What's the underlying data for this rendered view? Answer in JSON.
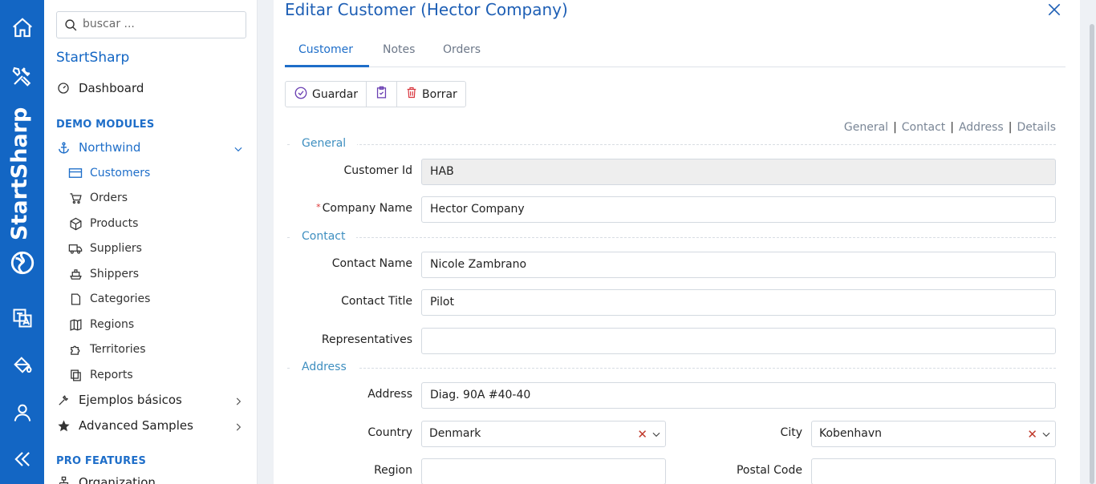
{
  "rail": {
    "brand": "StartSharp",
    "icons": [
      "home-icon",
      "tools-icon",
      "translate-icon",
      "paint-bucket-icon",
      "user-icon",
      "collapse-icon"
    ]
  },
  "sidebar": {
    "search_placeholder": "buscar ...",
    "title": "StartSharp",
    "dashboard": "Dashboard",
    "demo_modules": "DEMO MODULES",
    "northwind": "Northwind",
    "items": [
      {
        "label": "Customers",
        "icon": "table-icon"
      },
      {
        "label": "Orders",
        "icon": "cart-icon"
      },
      {
        "label": "Products",
        "icon": "cube-icon"
      },
      {
        "label": "Suppliers",
        "icon": "truck-icon"
      },
      {
        "label": "Shippers",
        "icon": "ship-icon"
      },
      {
        "label": "Categories",
        "icon": "folder-icon"
      },
      {
        "label": "Regions",
        "icon": "map-icon"
      },
      {
        "label": "Territories",
        "icon": "puzzle-icon"
      },
      {
        "label": "Reports",
        "icon": "copy-icon"
      }
    ],
    "basic_samples": "Ejemplos básicos",
    "advanced_samples": "Advanced Samples",
    "pro_features": "PRO FEATURES",
    "organization": "Organization"
  },
  "dialog": {
    "title": "Editar Customer (Hector Company)",
    "tabs": [
      "Customer",
      "Notes",
      "Orders"
    ],
    "toolbar": {
      "save": "Guardar",
      "delete": "Borrar"
    },
    "category_links": [
      "General",
      "Contact",
      "Address",
      "Details"
    ],
    "sections": {
      "general": "General",
      "contact": "Contact",
      "address": "Address"
    },
    "fields": {
      "customer_id": {
        "label": "Customer Id",
        "value": "HAB"
      },
      "company_name": {
        "label": "Company Name",
        "value": "Hector Company"
      },
      "contact_name": {
        "label": "Contact Name",
        "value": "Nicole Zambrano"
      },
      "contact_title": {
        "label": "Contact Title",
        "value": "Pilot"
      },
      "representatives": {
        "label": "Representatives",
        "value": ""
      },
      "address": {
        "label": "Address",
        "value": "Diag. 90A #40-40"
      },
      "country": {
        "label": "Country",
        "value": "Denmark"
      },
      "city": {
        "label": "City",
        "value": "Kobenhavn"
      },
      "region": {
        "label": "Region",
        "value": ""
      },
      "postal_code": {
        "label": "Postal Code",
        "value": ""
      }
    }
  },
  "colors": {
    "rail": "#1366c4",
    "accent": "#1e6ec9",
    "section": "#3f8fc0",
    "delete": "#d9363e",
    "required": "#dd3333"
  }
}
